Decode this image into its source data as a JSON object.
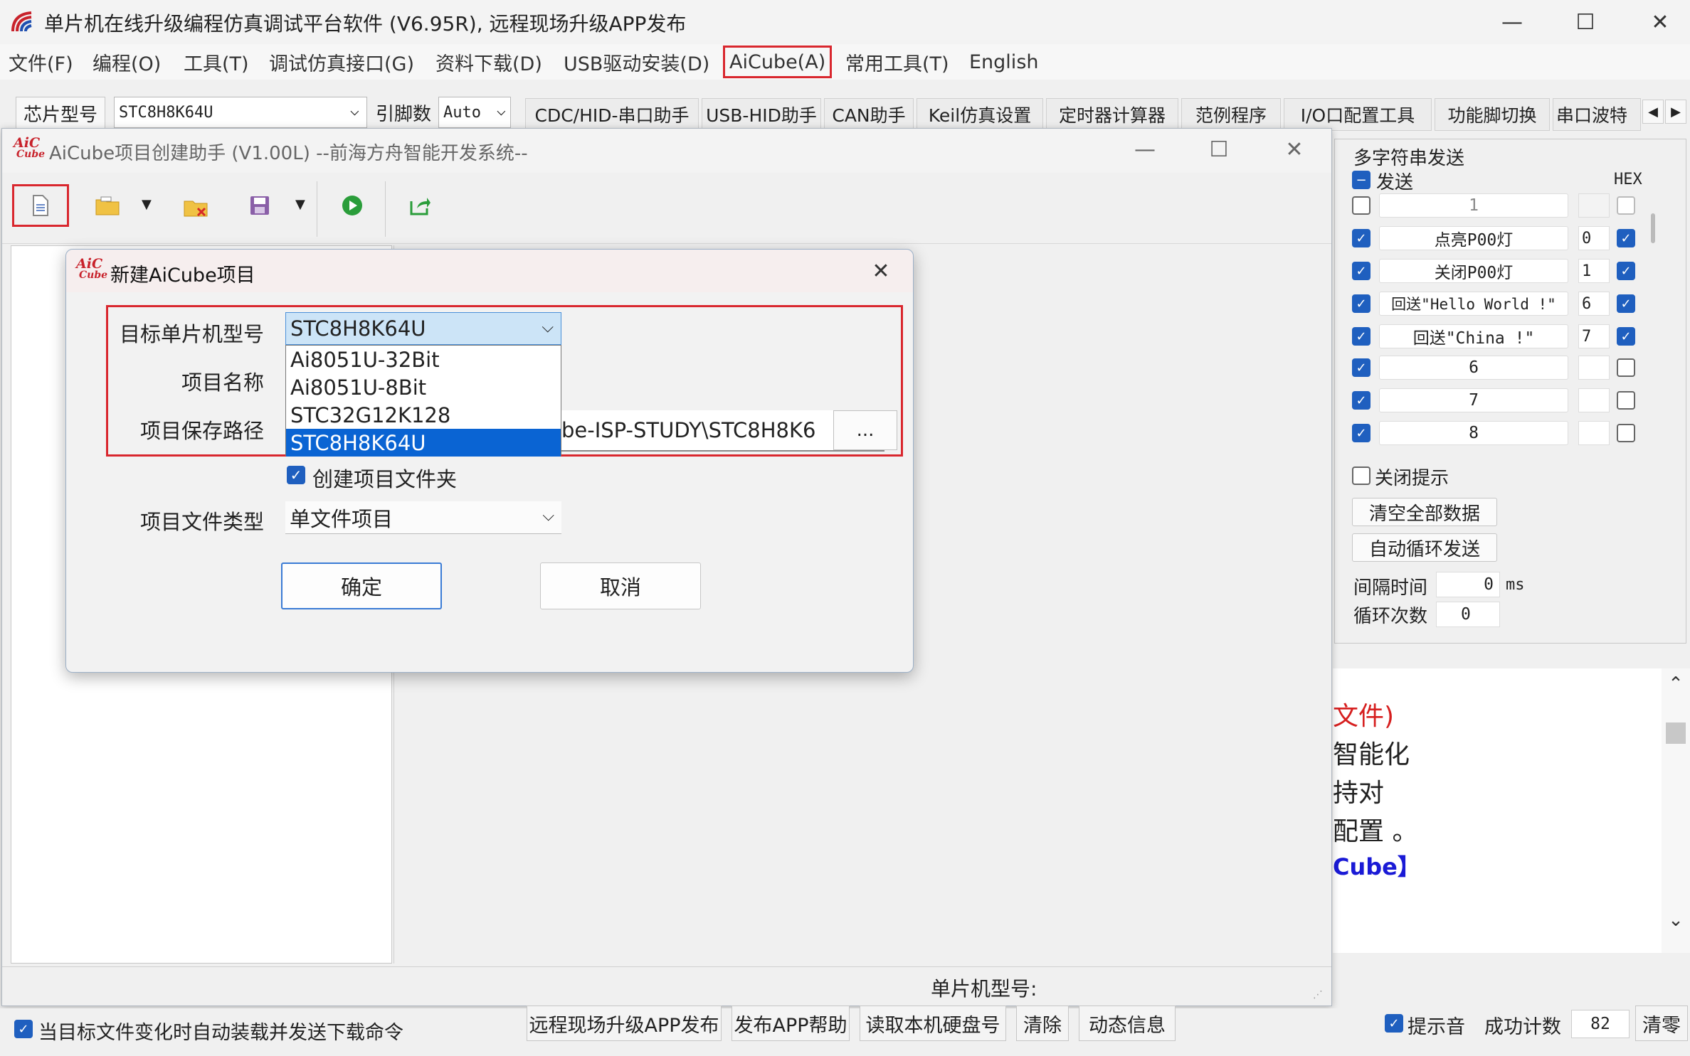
{
  "main": {
    "title": "单片机在线升级编程仿真调试平台软件 (V6.95R), 远程现场升级APP发布"
  },
  "menubar": [
    "文件(F)",
    "编程(O)",
    "工具(T)",
    "调试仿真接口(G)",
    "资料下载(D)",
    "USB驱动安装(D)",
    "AiCube(A)",
    "常用工具(T)",
    "English"
  ],
  "toolbar": {
    "chip_label": "芯片型号",
    "chip_value": "STC8H8K64U",
    "pin_label": "引脚数",
    "pin_value": "Auto",
    "tabs": [
      "CDC/HID-串口助手",
      "USB-HID助手",
      "CAN助手",
      "Keil仿真设置",
      "定时器计算器",
      "范例程序",
      "I/O口配置工具",
      "功能脚切换",
      "串口波特"
    ]
  },
  "aicube": {
    "logo_top": "AiC",
    "logo_bottom": "Cube",
    "title": "AiCube项目创建助手 (V1.00L) --前海方舟智能开发系统--",
    "status_chip_label": "单片机型号:"
  },
  "dialog": {
    "title": "新建AiCube项目",
    "target_label": "目标单片机型号",
    "target_value": "STC8H8K64U",
    "options": [
      "Ai8051U-32Bit",
      "Ai8051U-8Bit",
      "STC32G12K128",
      "STC8H8K64U"
    ],
    "name_label": "项目名称",
    "path_label": "项目保存路径",
    "path_value": "be-ISP-STUDY\\STC8H8K6",
    "browse_label": "...",
    "create_folder_label": "创建项目文件夹",
    "type_label": "项目文件类型",
    "type_value": "单文件项目",
    "ok_label": "确定",
    "cancel_label": "取消"
  },
  "multi_send": {
    "title": "多字符串发送",
    "send_label": "发送",
    "hex_label": "HEX",
    "rows": [
      {
        "text": "1",
        "hex": ""
      },
      {
        "text": "点亮P00灯",
        "hex": "0"
      },
      {
        "text": "关闭P00灯",
        "hex": "1"
      },
      {
        "text": "回送\"Hello World !\"",
        "hex": "6"
      },
      {
        "text": "回送\"China !\"",
        "hex": "7"
      },
      {
        "text": "6",
        "hex": ""
      },
      {
        "text": "7",
        "hex": ""
      },
      {
        "text": "8",
        "hex": ""
      }
    ],
    "close_hint_label": "关闭提示",
    "clear_all_label": "清空全部数据",
    "auto_loop_label": "自动循环发送",
    "interval_label": "间隔时间",
    "interval_value": "0",
    "interval_unit": "ms",
    "loop_count_label": "循环次数",
    "loop_count_value": "0"
  },
  "log": {
    "lines": [
      "文件)",
      "智能化",
      "持对",
      "配置 。",
      "Cube】"
    ]
  },
  "bottom": {
    "auto_load_label": "当目标文件变化时自动装载并发送下载命令",
    "buttons": [
      "远程现场升级APP发布",
      "发布APP帮助",
      "读取本机硬盘号",
      "清除",
      "动态信息"
    ],
    "sound_label": "提示音",
    "success_label": "成功计数",
    "success_value": "82",
    "clear_zero_label": "清零"
  }
}
